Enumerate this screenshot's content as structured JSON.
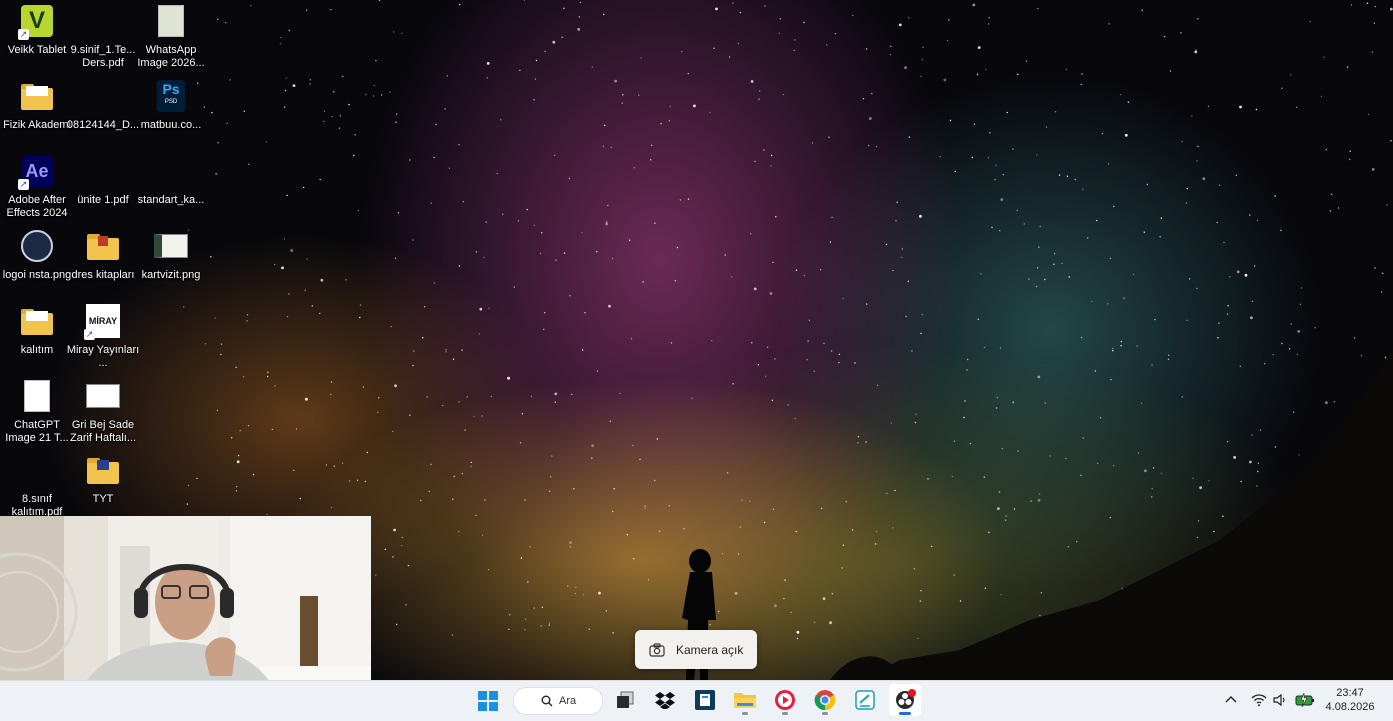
{
  "desktop_icons": [
    {
      "label": "Veikk Tablet",
      "icon": "veikk-shortcut-icon"
    },
    {
      "label": "9.sinif_1.Te... Ders.pdf",
      "icon": "pdf-file-icon"
    },
    {
      "label": "WhatsApp Image 2026...",
      "icon": "image-file-icon"
    },
    {
      "label": "Fizik Akademi",
      "icon": "folder-icon"
    },
    {
      "label": "08124144_D...",
      "icon": "file-icon"
    },
    {
      "label": "matbuu.co...",
      "icon": "photoshop-file-icon"
    },
    {
      "label": "Adobe After Effects 2024",
      "icon": "after-effects-icon"
    },
    {
      "label": "ünite 1.pdf",
      "icon": "pdf-file-icon"
    },
    {
      "label": "standart_ka...",
      "icon": "file-icon"
    },
    {
      "label": "logoi nsta.png",
      "icon": "logo-image-icon"
    },
    {
      "label": "dres kitapları",
      "icon": "folder-icon"
    },
    {
      "label": "kartvizit.png",
      "icon": "image-file-icon"
    },
    {
      "label": "kalıtım",
      "icon": "folder-icon"
    },
    {
      "label": "Miray Yayınları ...",
      "icon": "miray-shortcut-icon"
    },
    {
      "label": "ChatGPT Image 21 T...",
      "icon": "image-file-icon"
    },
    {
      "label": "Gri Bej Sade Zarif Haftalı...",
      "icon": "image-file-icon"
    },
    {
      "label": "8.sınıf kalıtım.pdf",
      "icon": "pdf-file-icon"
    },
    {
      "label": "TYT",
      "icon": "folder-icon"
    }
  ],
  "icon_texts": {
    "veikk": "V",
    "after_effects": "Ae",
    "photoshop": "Ps",
    "photoshop_sub": "PSD",
    "miray": "MİRAY"
  },
  "camera_toast": {
    "label": "Kamera açık",
    "icon": "camera-icon"
  },
  "taskbar": {
    "search_label": "Ara",
    "apps": [
      {
        "name": "start-button",
        "icon": "windows-logo-icon"
      },
      {
        "name": "task-view",
        "icon": "task-view-icon"
      },
      {
        "name": "dropbox",
        "icon": "dropbox-icon"
      },
      {
        "name": "book-app",
        "icon": "book-app-icon"
      },
      {
        "name": "file-explorer",
        "icon": "folder-icon"
      },
      {
        "name": "media-player",
        "icon": "play-icon"
      },
      {
        "name": "chrome",
        "icon": "chrome-icon"
      },
      {
        "name": "sticky-app",
        "icon": "note-icon"
      },
      {
        "name": "obs",
        "icon": "obs-icon"
      }
    ],
    "clock": {
      "time": "23:47",
      "date": "4.08.2026"
    }
  },
  "colors": {
    "taskbar_bg": "#eef1f5",
    "accent": "#1a6ee0",
    "folder": "#f1c44e",
    "toast_bg": "#f3f1ee"
  }
}
